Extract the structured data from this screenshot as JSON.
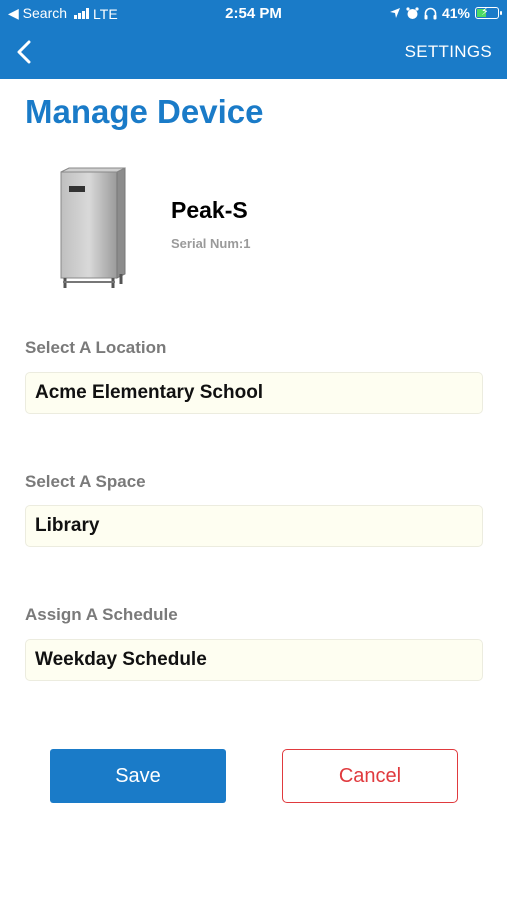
{
  "status_bar": {
    "back_app": "◀ Search",
    "carrier": "LTE",
    "time": "2:54 PM",
    "battery": "41%",
    "battery_level": 0.41
  },
  "nav": {
    "back_icon": "chevron-left-icon",
    "settings_label": "SETTINGS"
  },
  "page": {
    "title": "Manage Device"
  },
  "device": {
    "name": "Peak-S",
    "serial": "Serial Num:1"
  },
  "fields": {
    "location": {
      "label": "Select A Location",
      "value": "Acme Elementary School"
    },
    "space": {
      "label": "Select A Space",
      "value": "Library"
    },
    "schedule": {
      "label": "Assign A Schedule",
      "value": "Weekday Schedule"
    }
  },
  "actions": {
    "save_label": "Save",
    "cancel_label": "Cancel"
  },
  "colors": {
    "brand_blue": "#1a7bc8",
    "cancel_red": "#e03a3e",
    "field_bg": "#fefef1"
  }
}
